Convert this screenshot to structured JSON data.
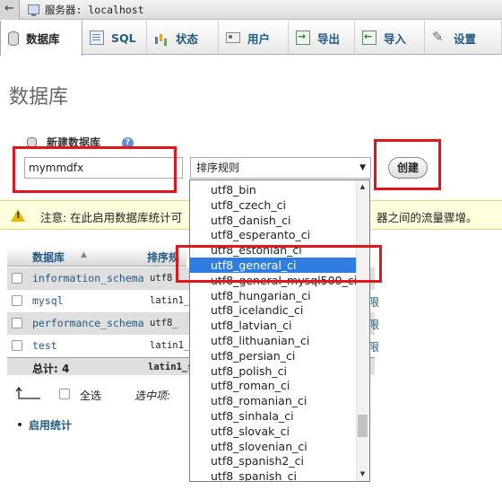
{
  "serverbar": {
    "back_glyph": "←",
    "label": "服务器: localhost"
  },
  "tabs": [
    {
      "label": "数据库",
      "icon": "database-icon"
    },
    {
      "label": "SQL",
      "icon": "sql-icon"
    },
    {
      "label": "状态",
      "icon": "status-icon"
    },
    {
      "label": "用户",
      "icon": "users-icon"
    },
    {
      "label": "导出",
      "icon": "export-icon"
    },
    {
      "label": "导入",
      "icon": "import-icon"
    },
    {
      "label": "设置",
      "icon": "settings-icon"
    }
  ],
  "page_title": "数据库",
  "create": {
    "label": "新建数据库",
    "help_glyph": "?",
    "db_name_value": "mymmdfx",
    "collation_value": "排序规则",
    "create_button": "创建"
  },
  "notice": {
    "icon_glyph": "!",
    "text_left": "注意: 在此启用数据库统计可",
    "text_right": "器之间的流量骤增。"
  },
  "table": {
    "header_db": "数据库",
    "header_collation": "排序规则",
    "sort_glyph": "▲",
    "rows": [
      {
        "name": "information_schema",
        "collation": "utf8",
        "priv": ""
      },
      {
        "name": "mysql",
        "collation": "latin1_",
        "priv": "限"
      },
      {
        "name": "performance_schema",
        "collation": "utf8_",
        "priv": "限"
      },
      {
        "name": "test",
        "collation": "latin1_",
        "priv": "限"
      }
    ],
    "total_label": "总计: 4",
    "total_collation": "latin1_s"
  },
  "bottom": {
    "select_all": "全选",
    "with_selected": "选中项:",
    "enable_stats": "启用统计"
  },
  "dropdown": {
    "selected": "utf8_general_ci",
    "options": [
      "utf8_bin",
      "utf8_czech_ci",
      "utf8_danish_ci",
      "utf8_esperanto_ci",
      "utf8_estonian_ci",
      "utf8_general_ci",
      "utf8_general_mysql500_ci",
      "utf8_hungarian_ci",
      "utf8_icelandic_ci",
      "utf8_latvian_ci",
      "utf8_lithuanian_ci",
      "utf8_persian_ci",
      "utf8_polish_ci",
      "utf8_roman_ci",
      "utf8_romanian_ci",
      "utf8_sinhala_ci",
      "utf8_slovak_ci",
      "utf8_slovenian_ci",
      "utf8_spanish2_ci",
      "utf8_spanish_ci"
    ],
    "scroll_up_glyph": "▲",
    "scroll_down_glyph": "▼"
  },
  "colors": {
    "highlight_red": "#e0161e",
    "selection_blue": "#2f7de1",
    "link_blue": "#235a81",
    "notice_bg": "#ffffdd"
  }
}
